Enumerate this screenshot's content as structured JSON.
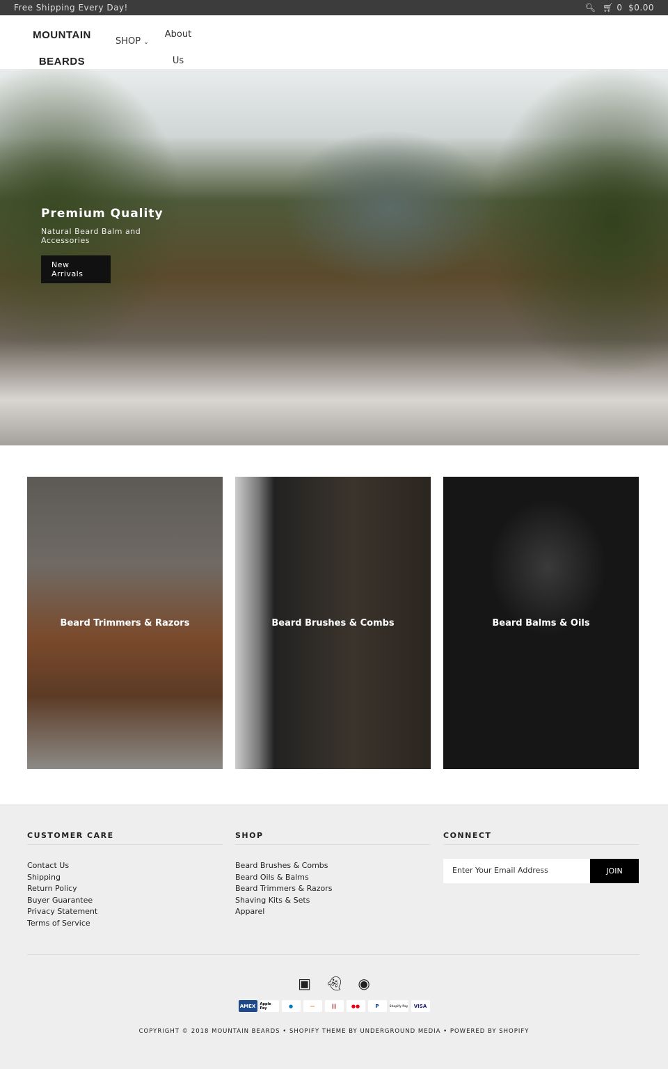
{
  "topbar": {
    "announcement": "Free Shipping Every Day!",
    "search_icon": "search-icon",
    "cart_icon": "cart-icon",
    "cart_count": "0",
    "cart_total": "$0.00"
  },
  "header": {
    "logo_line1": "MOUNTAIN",
    "logo_line2": "BEARDS",
    "nav": {
      "shop": "SHOP",
      "about_line1": "About",
      "about_line2": "Us"
    }
  },
  "hero": {
    "title": "Premium Quality",
    "subtitle": "Natural Beard Balm and Accessories",
    "button": "New Arrivals"
  },
  "collections": [
    {
      "label": "Beard Trimmers & Razors"
    },
    {
      "label": "Beard Brushes & Combs"
    },
    {
      "label": "Beard Balms & Oils"
    }
  ],
  "footer": {
    "customer_care": {
      "title": "CUSTOMER CARE",
      "links": [
        "Contact Us",
        "Shipping",
        "Return Policy",
        "Buyer Guarantee",
        "Privacy Statement",
        "Terms of Service"
      ]
    },
    "shop": {
      "title": "SHOP",
      "links": [
        "Beard Brushes & Combs",
        "Beard Oils & Balms",
        "Beard Trimmers & Razors",
        "Shaving Kits & Sets",
        "Apparel"
      ]
    },
    "connect": {
      "title": "CONNECT",
      "email_placeholder": "Enter Your Email Address",
      "join": "JOIN"
    },
    "social": [
      "instagram-icon",
      "snapchat-icon",
      "weibo-icon"
    ],
    "payments": [
      "AMEX",
      "Apple Pay",
      "Diners",
      "Discover",
      "JCB",
      "Mastercard",
      "PayPal",
      "Shopify Pay",
      "VISA"
    ],
    "copyright": "COPYRIGHT © 2018 MOUNTAIN BEARDS • SHOPIFY THEME BY UNDERGROUND MEDIA •  POWERED BY SHOPIFY"
  }
}
